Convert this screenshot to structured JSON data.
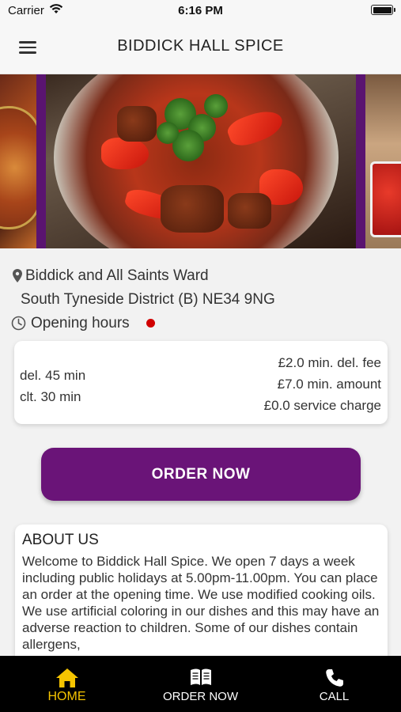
{
  "status_bar": {
    "carrier": "Carrier",
    "time": "6:16 PM"
  },
  "header": {
    "title": "BIDDICK HALL SPICE"
  },
  "address": {
    "line1": "Biddick and All Saints Ward",
    "line2": "South Tyneside District (B)  NE34 9NG"
  },
  "opening_hours": {
    "label": "Opening hours",
    "status_color": "#d10000"
  },
  "info": {
    "delivery_time": "del. 45 min",
    "collection_time": "clt. 30 min",
    "min_delivery_fee": "£2.0 min. del. fee",
    "min_amount": "£7.0 min. amount",
    "service_charge": "£0.0 service charge"
  },
  "order_button": {
    "label": "ORDER NOW"
  },
  "about": {
    "title": "ABOUT US",
    "text": "Welcome to Biddick Hall Spice. We open 7 days a week including public holidays at 5.00pm-11.00pm. You can place an order at the opening time. We use modified cooking oils. We use artificial coloring in our dishes and this may have an adverse reaction to children. Some of our dishes contain allergens,"
  },
  "tabs": [
    {
      "label": "HOME",
      "icon": "home-icon",
      "active": true
    },
    {
      "label": "ORDER NOW",
      "icon": "menu-book-icon",
      "active": false
    },
    {
      "label": "CALL",
      "icon": "phone-icon",
      "active": false
    }
  ],
  "colors": {
    "brand": "#6a1478",
    "active_tab": "#f5c400",
    "tab_bar_bg": "#000000"
  }
}
